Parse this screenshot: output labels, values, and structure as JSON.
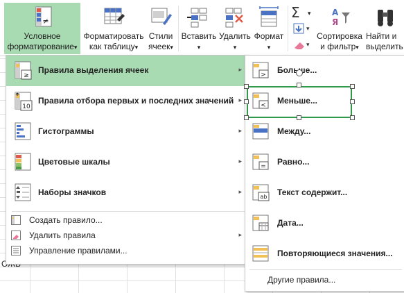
{
  "ribbon": {
    "buttons": [
      {
        "id": "cond",
        "line1": "Условное",
        "line2": "форматирование",
        "arrow": "▾"
      },
      {
        "id": "fmt_table",
        "line1": "Форматировать",
        "line2": "как таблицу",
        "arrow": "▾"
      },
      {
        "id": "styles",
        "line1": "Стили",
        "line2": "ячеек",
        "arrow": "▾"
      },
      {
        "id": "insert",
        "line1": "Вставить",
        "line2": "",
        "arrow": "▾"
      },
      {
        "id": "delete",
        "line1": "Удалить",
        "line2": "",
        "arrow": "▾"
      },
      {
        "id": "format",
        "line1": "Формат",
        "line2": "",
        "arrow": "▾"
      },
      {
        "id": "sort",
        "line1": "Сортировка",
        "line2": "и фильтр",
        "arrow": "▾"
      },
      {
        "id": "find",
        "line1": "Найти и",
        "line2": "выделить",
        "arrow": ""
      }
    ],
    "sigma": "Σ",
    "cf_icon_text": "≠"
  },
  "sheet": {
    "cell_text": "ОЖЬ"
  },
  "menu": {
    "items": [
      {
        "label": "Правила выделения ячеек",
        "arrow": "▸",
        "icon_text": "≥"
      },
      {
        "label": "Правила отбора первых и последних значений",
        "arrow": "▸",
        "icon_text": "10"
      },
      {
        "label": "Гистограммы",
        "arrow": "▸"
      },
      {
        "label": "Цветовые шкалы",
        "arrow": "▸"
      },
      {
        "label": "Наборы значков",
        "arrow": "▸"
      }
    ],
    "small_items": [
      {
        "label": "Создать правило...",
        "arrow": ""
      },
      {
        "label": "Удалить правила",
        "arrow": "▸"
      },
      {
        "label": "Управление правилами...",
        "arrow": ""
      }
    ]
  },
  "submenu": {
    "items": [
      {
        "label": "Больше...",
        "icon_text": ">"
      },
      {
        "label": "Меньше...",
        "icon_text": "<"
      },
      {
        "label": "Между...",
        "icon_text": ""
      },
      {
        "label": "Равно...",
        "icon_text": "="
      },
      {
        "label": "Текст содержит...",
        "icon_text": "ab"
      },
      {
        "label": "Дата...",
        "icon_text": ""
      },
      {
        "label": "Повторяющиеся значения...",
        "icon_text": ""
      }
    ],
    "other": "Другие правила...",
    "accent": "#2e9a4a"
  },
  "colors": {
    "highlight": "#a9dbb3",
    "selection_border": "#2e9a4a"
  }
}
